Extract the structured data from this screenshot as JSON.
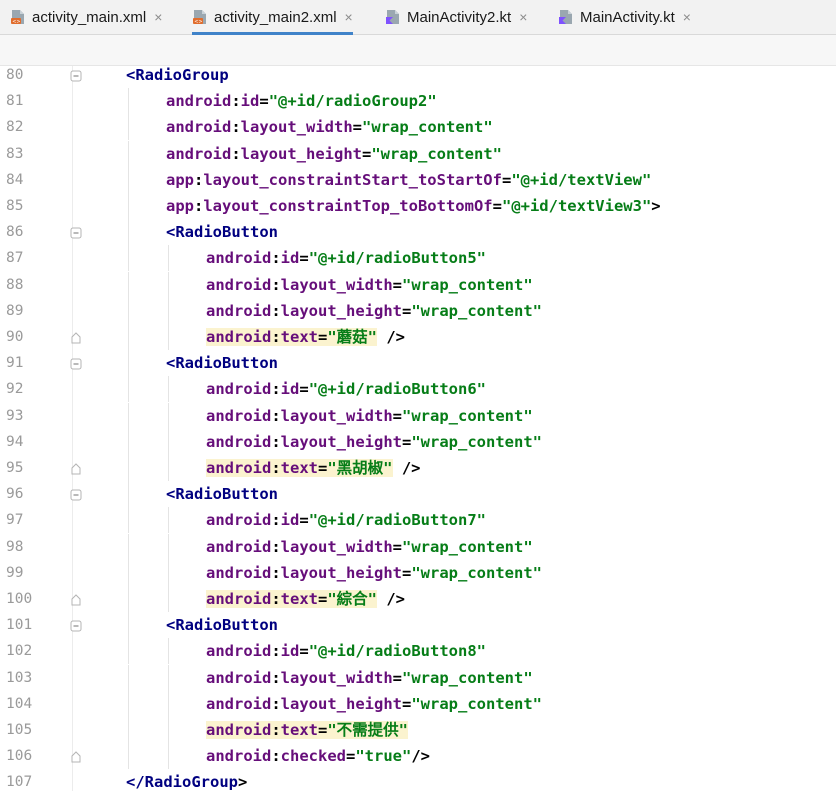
{
  "tabs": [
    {
      "label": "activity_main.xml",
      "icon": "xml-file-icon",
      "active": false
    },
    {
      "label": "activity_main2.xml",
      "icon": "xml-file-icon",
      "active": true
    },
    {
      "label": "MainActivity2.kt",
      "icon": "kotlin-file-icon",
      "active": false
    },
    {
      "label": "MainActivity.kt",
      "icon": "kotlin-file-icon",
      "active": false
    }
  ],
  "close_glyph": "×",
  "colors": {
    "tag": "#000080",
    "attribute": "#660e7a",
    "string": "#067d17",
    "highlight": "#fbf3cf",
    "tab_active": "#4083c9"
  },
  "lines": [
    {
      "n": "80",
      "indent": 1,
      "fold": "open",
      "tokens": [
        [
          "tag",
          "<RadioGroup"
        ]
      ]
    },
    {
      "n": "81",
      "indent": 2,
      "tokens": [
        [
          "ns",
          "android"
        ],
        [
          "punct",
          ":"
        ],
        [
          "attr",
          "id"
        ],
        [
          "punct",
          "="
        ],
        [
          "str",
          "\"@+id/radioGroup2\""
        ]
      ]
    },
    {
      "n": "82",
      "indent": 2,
      "tokens": [
        [
          "ns",
          "android"
        ],
        [
          "punct",
          ":"
        ],
        [
          "attr",
          "layout_width"
        ],
        [
          "punct",
          "="
        ],
        [
          "str",
          "\"wrap_content\""
        ]
      ]
    },
    {
      "n": "83",
      "indent": 2,
      "tokens": [
        [
          "ns",
          "android"
        ],
        [
          "punct",
          ":"
        ],
        [
          "attr",
          "layout_height"
        ],
        [
          "punct",
          "="
        ],
        [
          "str",
          "\"wrap_content\""
        ]
      ]
    },
    {
      "n": "84",
      "indent": 2,
      "tokens": [
        [
          "ns",
          "app"
        ],
        [
          "punct",
          ":"
        ],
        [
          "attr",
          "layout_constraintStart_toStartOf"
        ],
        [
          "punct",
          "="
        ],
        [
          "str",
          "\"@+id/textView\""
        ]
      ]
    },
    {
      "n": "85",
      "indent": 2,
      "tokens": [
        [
          "ns",
          "app"
        ],
        [
          "punct",
          ":"
        ],
        [
          "attr",
          "layout_constraintTop_toBottomOf"
        ],
        [
          "punct",
          "="
        ],
        [
          "str",
          "\"@+id/textView3\""
        ],
        [
          "punct",
          ">"
        ]
      ]
    },
    {
      "n": "86",
      "indent": 2,
      "fold": "open",
      "tokens": [
        [
          "tag",
          "<RadioButton"
        ]
      ]
    },
    {
      "n": "87",
      "indent": 3,
      "tokens": [
        [
          "ns",
          "android"
        ],
        [
          "punct",
          ":"
        ],
        [
          "attr",
          "id"
        ],
        [
          "punct",
          "="
        ],
        [
          "str",
          "\"@+id/radioButton5\""
        ]
      ]
    },
    {
      "n": "88",
      "indent": 3,
      "tokens": [
        [
          "ns",
          "android"
        ],
        [
          "punct",
          ":"
        ],
        [
          "attr",
          "layout_width"
        ],
        [
          "punct",
          "="
        ],
        [
          "str",
          "\"wrap_content\""
        ]
      ]
    },
    {
      "n": "89",
      "indent": 3,
      "tokens": [
        [
          "ns",
          "android"
        ],
        [
          "punct",
          ":"
        ],
        [
          "attr",
          "layout_height"
        ],
        [
          "punct",
          "="
        ],
        [
          "str",
          "\"wrap_content\""
        ]
      ]
    },
    {
      "n": "90",
      "indent": 3,
      "fold": "close",
      "highlight": true,
      "tokens": [
        [
          "ns",
          "android"
        ],
        [
          "punct",
          ":"
        ],
        [
          "attr",
          "text"
        ],
        [
          "punct",
          "="
        ],
        [
          "str",
          "\"蘑菇\""
        ],
        [
          "punct",
          " />"
        ]
      ]
    },
    {
      "n": "91",
      "indent": 2,
      "fold": "open",
      "tokens": [
        [
          "tag",
          "<RadioButton"
        ]
      ]
    },
    {
      "n": "92",
      "indent": 3,
      "tokens": [
        [
          "ns",
          "android"
        ],
        [
          "punct",
          ":"
        ],
        [
          "attr",
          "id"
        ],
        [
          "punct",
          "="
        ],
        [
          "str",
          "\"@+id/radioButton6\""
        ]
      ]
    },
    {
      "n": "93",
      "indent": 3,
      "tokens": [
        [
          "ns",
          "android"
        ],
        [
          "punct",
          ":"
        ],
        [
          "attr",
          "layout_width"
        ],
        [
          "punct",
          "="
        ],
        [
          "str",
          "\"wrap_content\""
        ]
      ]
    },
    {
      "n": "94",
      "indent": 3,
      "tokens": [
        [
          "ns",
          "android"
        ],
        [
          "punct",
          ":"
        ],
        [
          "attr",
          "layout_height"
        ],
        [
          "punct",
          "="
        ],
        [
          "str",
          "\"wrap_content\""
        ]
      ]
    },
    {
      "n": "95",
      "indent": 3,
      "fold": "close",
      "highlight": true,
      "tokens": [
        [
          "ns",
          "android"
        ],
        [
          "punct",
          ":"
        ],
        [
          "attr",
          "text"
        ],
        [
          "punct",
          "="
        ],
        [
          "str",
          "\"黑胡椒\""
        ],
        [
          "punct",
          " />"
        ]
      ]
    },
    {
      "n": "96",
      "indent": 2,
      "fold": "open",
      "tokens": [
        [
          "tag",
          "<RadioButton"
        ]
      ]
    },
    {
      "n": "97",
      "indent": 3,
      "tokens": [
        [
          "ns",
          "android"
        ],
        [
          "punct",
          ":"
        ],
        [
          "attr",
          "id"
        ],
        [
          "punct",
          "="
        ],
        [
          "str",
          "\"@+id/radioButton7\""
        ]
      ]
    },
    {
      "n": "98",
      "indent": 3,
      "tokens": [
        [
          "ns",
          "android"
        ],
        [
          "punct",
          ":"
        ],
        [
          "attr",
          "layout_width"
        ],
        [
          "punct",
          "="
        ],
        [
          "str",
          "\"wrap_content\""
        ]
      ]
    },
    {
      "n": "99",
      "indent": 3,
      "tokens": [
        [
          "ns",
          "android"
        ],
        [
          "punct",
          ":"
        ],
        [
          "attr",
          "layout_height"
        ],
        [
          "punct",
          "="
        ],
        [
          "str",
          "\"wrap_content\""
        ]
      ]
    },
    {
      "n": "100",
      "indent": 3,
      "fold": "close",
      "highlight": true,
      "tokens": [
        [
          "ns",
          "android"
        ],
        [
          "punct",
          ":"
        ],
        [
          "attr",
          "text"
        ],
        [
          "punct",
          "="
        ],
        [
          "str",
          "\"綜合\""
        ],
        [
          "punct",
          " />"
        ]
      ]
    },
    {
      "n": "101",
      "indent": 2,
      "fold": "open",
      "tokens": [
        [
          "tag",
          "<RadioButton"
        ]
      ]
    },
    {
      "n": "102",
      "indent": 3,
      "tokens": [
        [
          "ns",
          "android"
        ],
        [
          "punct",
          ":"
        ],
        [
          "attr",
          "id"
        ],
        [
          "punct",
          "="
        ],
        [
          "str",
          "\"@+id/radioButton8\""
        ]
      ]
    },
    {
      "n": "103",
      "indent": 3,
      "tokens": [
        [
          "ns",
          "android"
        ],
        [
          "punct",
          ":"
        ],
        [
          "attr",
          "layout_width"
        ],
        [
          "punct",
          "="
        ],
        [
          "str",
          "\"wrap_content\""
        ]
      ]
    },
    {
      "n": "104",
      "indent": 3,
      "tokens": [
        [
          "ns",
          "android"
        ],
        [
          "punct",
          ":"
        ],
        [
          "attr",
          "layout_height"
        ],
        [
          "punct",
          "="
        ],
        [
          "str",
          "\"wrap_content\""
        ]
      ]
    },
    {
      "n": "105",
      "indent": 3,
      "highlight": true,
      "tokens": [
        [
          "ns",
          "android"
        ],
        [
          "punct",
          ":"
        ],
        [
          "attr",
          "text"
        ],
        [
          "punct",
          "="
        ],
        [
          "str",
          "\"不需提供\""
        ]
      ]
    },
    {
      "n": "106",
      "indent": 3,
      "fold": "close",
      "tokens": [
        [
          "ns",
          "android"
        ],
        [
          "punct",
          ":"
        ],
        [
          "attr",
          "checked"
        ],
        [
          "punct",
          "="
        ],
        [
          "str",
          "\"true\""
        ],
        [
          "punct",
          "/>"
        ]
      ]
    },
    {
      "n": "107",
      "indent": 1,
      "tokens": [
        [
          "tag",
          "</RadioGroup"
        ],
        [
          "punct",
          ">"
        ]
      ]
    }
  ]
}
